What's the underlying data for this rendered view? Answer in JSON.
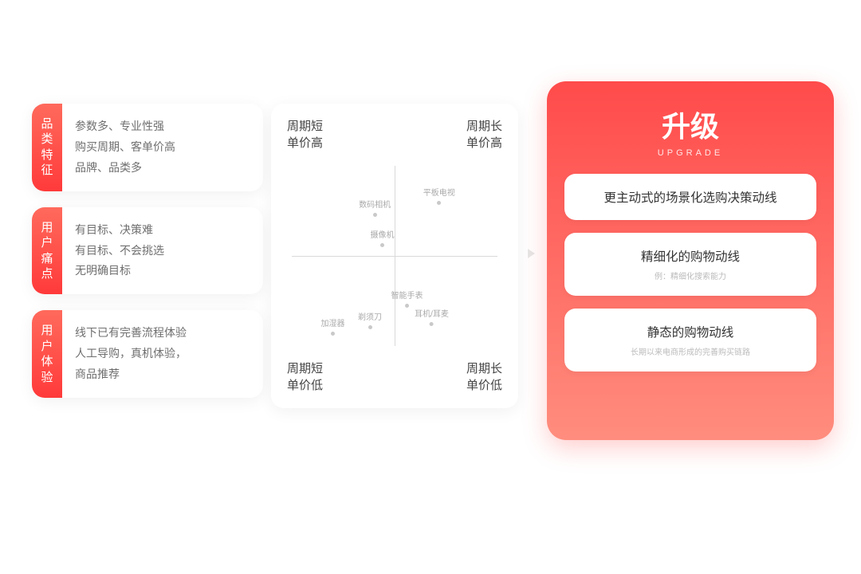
{
  "left": {
    "cards": [
      {
        "tag": "品类特征",
        "lines": [
          "参数多、专业性强",
          "购买周期、客单价高",
          "品牌、品类多"
        ]
      },
      {
        "tag": "用户痛点",
        "lines": [
          "有目标、决策难",
          "有目标、不会挑选",
          "无明确目标"
        ]
      },
      {
        "tag": "用户体验",
        "lines": [
          "线下已有完善流程体验",
          "人工导购，真机体验，",
          "商品推荐"
        ]
      }
    ]
  },
  "quadrant": {
    "labels": {
      "tl": "周期短\n单价高",
      "tr": "周期长\n单价高",
      "bl": "周期短\n单价低",
      "br": "周期长\n单价低"
    },
    "points": [
      {
        "name": "平板电视",
        "x": 68,
        "y": 30
      },
      {
        "name": "数码相机",
        "x": 42,
        "y": 34
      },
      {
        "name": "摄像机",
        "x": 45,
        "y": 44
      },
      {
        "name": "智能手表",
        "x": 55,
        "y": 64
      },
      {
        "name": "耳机/耳麦",
        "x": 65,
        "y": 70
      },
      {
        "name": "剃须刀",
        "x": 40,
        "y": 71
      },
      {
        "name": "加湿器",
        "x": 25,
        "y": 73
      }
    ]
  },
  "upgrade": {
    "title": "升级",
    "subtitle": "UPGRADE",
    "items": [
      {
        "main": "更主动式的场景化选购决策动线",
        "sub": ""
      },
      {
        "main": "精细化的购物动线",
        "sub": "例：精细化搜索能力"
      },
      {
        "main": "静态的购物动线",
        "sub": "长期以来电商形成的完善购买链路"
      }
    ]
  }
}
